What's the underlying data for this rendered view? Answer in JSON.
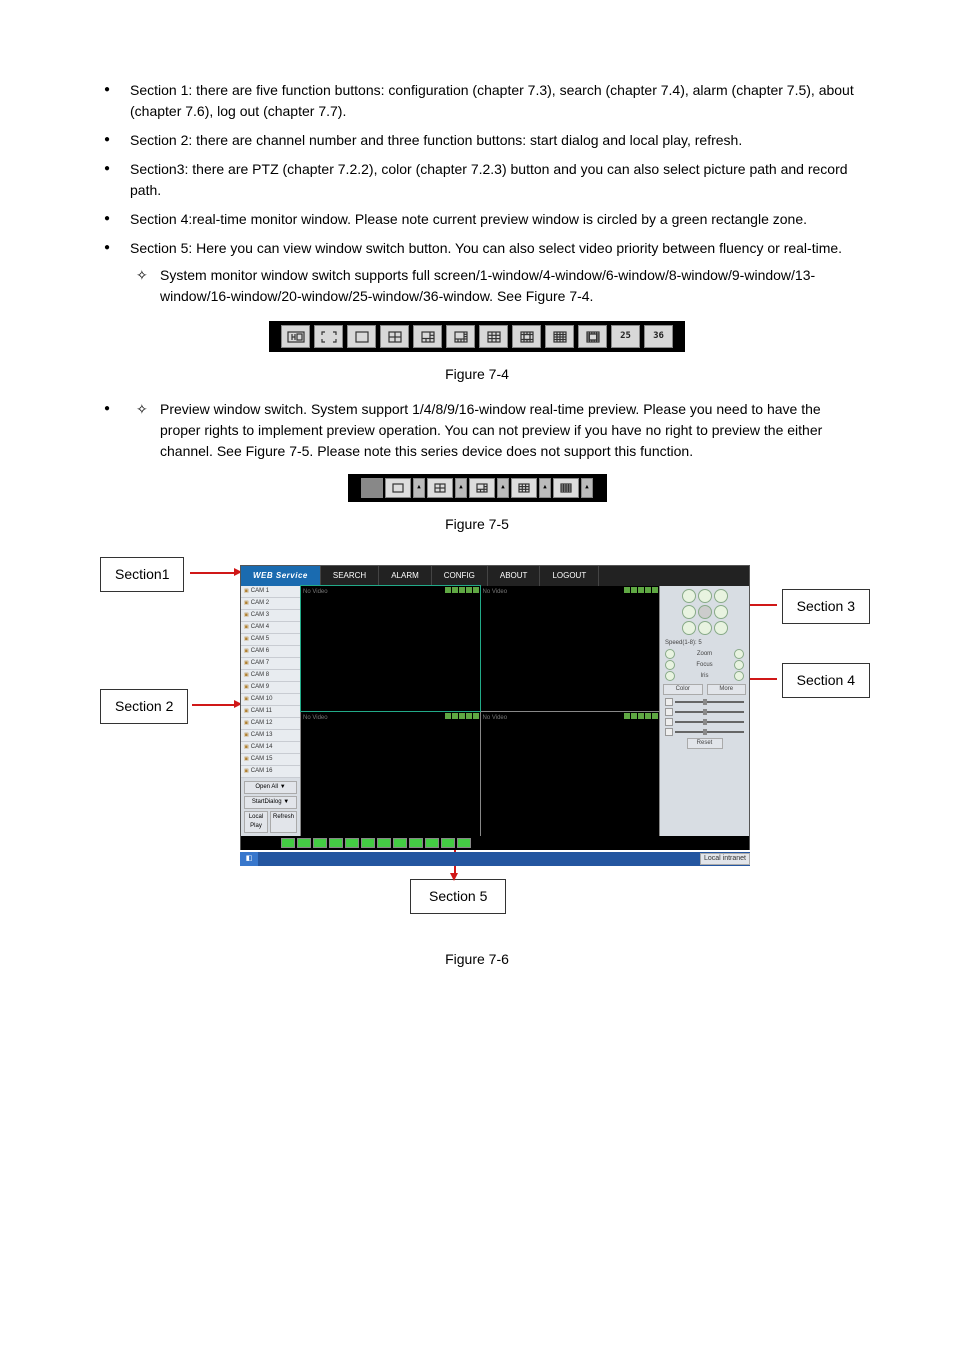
{
  "bullets": {
    "s1": "Section 1: there are five function buttons: configuration (chapter 7.3), search (chapter 7.4), alarm (chapter 7.5), about (chapter 7.6), log out (chapter 7.7).",
    "s2": "Section 2: there are channel number and three function buttons: start dialog and local play, refresh.",
    "s3": "Section3: there are PTZ (chapter 7.2.2), color (chapter 7.2.3) button and you can also select picture path and record path.",
    "s4": "Section 4:real-time monitor window. Please note current preview window is circled by a green rectangle zone.",
    "s5": "Section 5: Here you can view window switch button.  You can also select video priority between fluency or real-time.",
    "s5_sub1": "System monitor window switch supports full screen/1-window/4-window/6-window/8-window/9-window/13-window/16-window/20-window/25-window/36-window. See Figure 7-4.",
    "s5_sub2": "Preview window switch. System support 1/4/8/9/16-window real-time preview. Please you need to have the proper rights to implement preview operation. You can not preview if you have no right to preview the either channel. See Figure 7-5. Please note this series device does not support this function."
  },
  "figures": {
    "f74": "Figure 7-4",
    "f75": "Figure 7-5",
    "f76": "Figure 7-6"
  },
  "section_labels": {
    "s1": "Section1",
    "s2": "Section 2",
    "s3": "Section 3",
    "s4": "Section 4",
    "s5": "Section 5"
  },
  "app": {
    "logo": "WEB Service",
    "tabs": [
      "SEARCH",
      "ALARM",
      "CONFIG",
      "ABOUT",
      "LOGOUT"
    ],
    "cams": [
      "CAM 1",
      "CAM 2",
      "CAM 3",
      "CAM 4",
      "CAM 5",
      "CAM 6",
      "CAM 7",
      "CAM 8",
      "CAM 9",
      "CAM 10",
      "CAM 11",
      "CAM 12",
      "CAM 13",
      "CAM 14",
      "CAM 15",
      "CAM 16"
    ],
    "sidebtns": {
      "open": "Open All  ▼",
      "dlg": "StartDialog ▼",
      "lp": "Local Play",
      "rf": "Refresh"
    },
    "pane_text": "No Video",
    "rpanel": {
      "speed": "Speed(1-8): 5",
      "zoom": "Zoom",
      "focus": "Focus",
      "iris": "Iris",
      "tabColor": "Color",
      "tabMore": "More",
      "reset": "Reset"
    },
    "tray": "Local intranet"
  },
  "toolbar1": {
    "v25": "25",
    "v36": "36"
  }
}
